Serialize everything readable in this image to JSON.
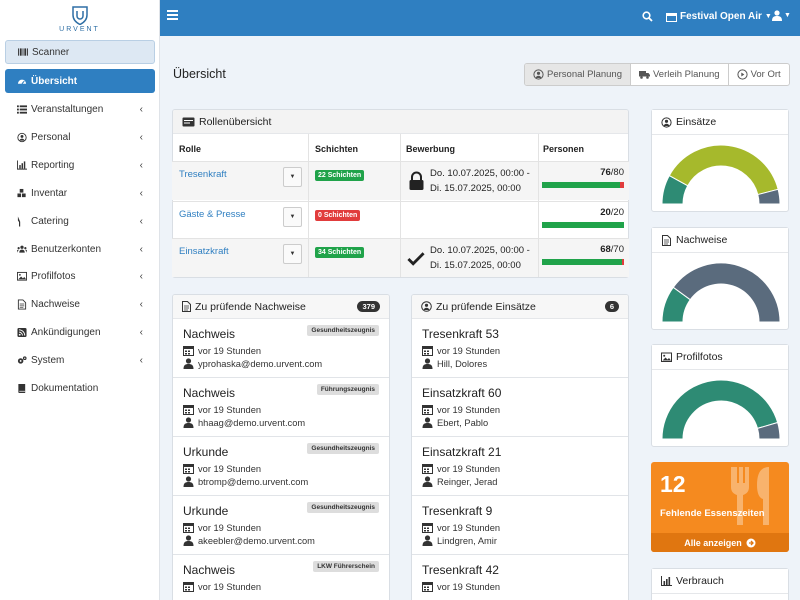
{
  "app": {
    "logo_text": "URVENT"
  },
  "sidebar": {
    "items": [
      {
        "label": "Scanner",
        "icon": "barcode-icon",
        "chevron": false
      },
      {
        "label": "Übersicht",
        "icon": "tachometer-icon",
        "chevron": false
      },
      {
        "label": "Veranstaltungen",
        "icon": "list-icon",
        "chevron": true
      },
      {
        "label": "Personal",
        "icon": "user-circle-icon",
        "chevron": true
      },
      {
        "label": "Reporting",
        "icon": "bar-chart-icon",
        "chevron": true
      },
      {
        "label": "Inventar",
        "icon": "cubes-icon",
        "chevron": true
      },
      {
        "label": "Catering",
        "icon": "cutlery-icon",
        "chevron": true
      },
      {
        "label": "Benutzerkonten",
        "icon": "users-icon",
        "chevron": true
      },
      {
        "label": "Profilfotos",
        "icon": "image-icon",
        "chevron": true
      },
      {
        "label": "Nachweise",
        "icon": "file-icon",
        "chevron": true
      },
      {
        "label": "Ankündigungen",
        "icon": "rss-icon",
        "chevron": true
      },
      {
        "label": "System",
        "icon": "cogs-icon",
        "chevron": true
      },
      {
        "label": "Dokumentation",
        "icon": "book-icon",
        "chevron": false
      }
    ]
  },
  "topbar": {
    "event": "Festival Open Air"
  },
  "page": {
    "title": "Übersicht"
  },
  "views": [
    "Personal Planung",
    "Verleih Planung",
    "Vor Ort"
  ],
  "roles": {
    "title": "Rollenübersicht",
    "columns": [
      "Rolle",
      "Schichten",
      "Bewerbung",
      "Personen"
    ],
    "rows": [
      {
        "name": "Tresenkraft",
        "shifts": "22 Schichten",
        "shift_color": "#20a34a",
        "status_icon": "lock-icon",
        "from": "Do. 10.07.2025, 00:00 -",
        "to": "Di. 15.07.2025, 00:00",
        "filled": "76",
        "total": "/80",
        "fraction": 0.95
      },
      {
        "name": "Gäste & Presse",
        "shifts": "0 Schichten",
        "shift_color": "#e13c3c",
        "status_icon": "",
        "from": "",
        "to": "",
        "filled": "20",
        "total": "/20",
        "fraction": 1.0
      },
      {
        "name": "Einsatzkraft",
        "shifts": "34 Schichten",
        "shift_color": "#20a34a",
        "status_icon": "check-icon",
        "from": "Do. 10.07.2025, 00:00 -",
        "to": "Di. 15.07.2025, 00:00",
        "filled": "68",
        "total": "/70",
        "fraction": 0.971
      }
    ]
  },
  "nachweise": {
    "title": "Zu prüfende Nachweise",
    "count": "379",
    "items": [
      {
        "title": "Nachweis",
        "tag": "Gesundheitszeugnis",
        "time": "vor 19 Stunden",
        "email": "yprohaska@demo.urvent.com"
      },
      {
        "title": "Nachweis",
        "tag": "Führungszeugnis",
        "time": "vor 19 Stunden",
        "email": "hhaag@demo.urvent.com"
      },
      {
        "title": "Urkunde",
        "tag": "Gesundheitszeugnis",
        "time": "vor 19 Stunden",
        "email": "btromp@demo.urvent.com"
      },
      {
        "title": "Urkunde",
        "tag": "Gesundheitszeugnis",
        "time": "vor 19 Stunden",
        "email": "akeebler@demo.urvent.com"
      },
      {
        "title": "Nachweis",
        "tag": "LKW Führerschein",
        "time": "vor 19 Stunden",
        "email": ""
      }
    ]
  },
  "einsaetze": {
    "title": "Zu prüfende Einsätze",
    "count": "6",
    "items": [
      {
        "title": "Tresenkraft 53",
        "time": "vor 19 Stunden",
        "person": "Hill, Dolores"
      },
      {
        "title": "Einsatzkraft 60",
        "time": "vor 19 Stunden",
        "person": "Ebert, Pablo"
      },
      {
        "title": "Einsatzkraft 21",
        "time": "vor 19 Stunden",
        "person": "Reinger, Jerad"
      },
      {
        "title": "Tresenkraft 9",
        "time": "vor 19 Stunden",
        "person": "Lindgren, Amir"
      },
      {
        "title": "Tresenkraft 42",
        "time": "vor 19 Stunden",
        "person": ""
      }
    ]
  },
  "gauges": [
    {
      "title": "Einsätze",
      "icon": "user-circle-icon",
      "segments": [
        {
          "color": "#2e8b74",
          "value": 0.16
        },
        {
          "color": "#a6b92c",
          "value": 0.76
        },
        {
          "color": "#5a6b7d",
          "value": 0.08
        }
      ]
    },
    {
      "title": "Nachweise",
      "icon": "file-icon",
      "segments": [
        {
          "color": "#2e8b74",
          "value": 0.2
        },
        {
          "color": "#5a6b7d",
          "value": 0.8
        }
      ]
    },
    {
      "title": "Profilfotos",
      "icon": "image-icon",
      "segments": [
        {
          "color": "#2e8b74",
          "value": 0.91
        },
        {
          "color": "#5a6b7d",
          "value": 0.09
        }
      ]
    }
  ],
  "essen": {
    "count": "12",
    "label": "Fehlende Essenszeiten",
    "link": "Alle anzeigen"
  },
  "verbrauch": {
    "title": "Verbrauch"
  },
  "colors": {
    "primary": "#2f7fc1",
    "success": "#20a34a",
    "danger": "#e13c3c",
    "warning": "#f58a1f"
  }
}
